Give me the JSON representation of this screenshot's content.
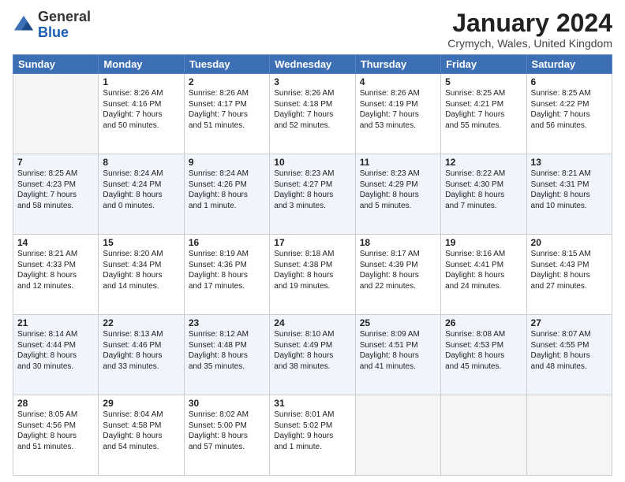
{
  "header": {
    "logo_general": "General",
    "logo_blue": "Blue",
    "month_title": "January 2024",
    "location": "Crymych, Wales, United Kingdom"
  },
  "days_of_week": [
    "Sunday",
    "Monday",
    "Tuesday",
    "Wednesday",
    "Thursday",
    "Friday",
    "Saturday"
  ],
  "weeks": [
    [
      {
        "day": "",
        "info": ""
      },
      {
        "day": "1",
        "info": "Sunrise: 8:26 AM\nSunset: 4:16 PM\nDaylight: 7 hours\nand 50 minutes."
      },
      {
        "day": "2",
        "info": "Sunrise: 8:26 AM\nSunset: 4:17 PM\nDaylight: 7 hours\nand 51 minutes."
      },
      {
        "day": "3",
        "info": "Sunrise: 8:26 AM\nSunset: 4:18 PM\nDaylight: 7 hours\nand 52 minutes."
      },
      {
        "day": "4",
        "info": "Sunrise: 8:26 AM\nSunset: 4:19 PM\nDaylight: 7 hours\nand 53 minutes."
      },
      {
        "day": "5",
        "info": "Sunrise: 8:25 AM\nSunset: 4:21 PM\nDaylight: 7 hours\nand 55 minutes."
      },
      {
        "day": "6",
        "info": "Sunrise: 8:25 AM\nSunset: 4:22 PM\nDaylight: 7 hours\nand 56 minutes."
      }
    ],
    [
      {
        "day": "7",
        "info": "Sunrise: 8:25 AM\nSunset: 4:23 PM\nDaylight: 7 hours\nand 58 minutes."
      },
      {
        "day": "8",
        "info": "Sunrise: 8:24 AM\nSunset: 4:24 PM\nDaylight: 8 hours\nand 0 minutes."
      },
      {
        "day": "9",
        "info": "Sunrise: 8:24 AM\nSunset: 4:26 PM\nDaylight: 8 hours\nand 1 minute."
      },
      {
        "day": "10",
        "info": "Sunrise: 8:23 AM\nSunset: 4:27 PM\nDaylight: 8 hours\nand 3 minutes."
      },
      {
        "day": "11",
        "info": "Sunrise: 8:23 AM\nSunset: 4:29 PM\nDaylight: 8 hours\nand 5 minutes."
      },
      {
        "day": "12",
        "info": "Sunrise: 8:22 AM\nSunset: 4:30 PM\nDaylight: 8 hours\nand 7 minutes."
      },
      {
        "day": "13",
        "info": "Sunrise: 8:21 AM\nSunset: 4:31 PM\nDaylight: 8 hours\nand 10 minutes."
      }
    ],
    [
      {
        "day": "14",
        "info": "Sunrise: 8:21 AM\nSunset: 4:33 PM\nDaylight: 8 hours\nand 12 minutes."
      },
      {
        "day": "15",
        "info": "Sunrise: 8:20 AM\nSunset: 4:34 PM\nDaylight: 8 hours\nand 14 minutes."
      },
      {
        "day": "16",
        "info": "Sunrise: 8:19 AM\nSunset: 4:36 PM\nDaylight: 8 hours\nand 17 minutes."
      },
      {
        "day": "17",
        "info": "Sunrise: 8:18 AM\nSunset: 4:38 PM\nDaylight: 8 hours\nand 19 minutes."
      },
      {
        "day": "18",
        "info": "Sunrise: 8:17 AM\nSunset: 4:39 PM\nDaylight: 8 hours\nand 22 minutes."
      },
      {
        "day": "19",
        "info": "Sunrise: 8:16 AM\nSunset: 4:41 PM\nDaylight: 8 hours\nand 24 minutes."
      },
      {
        "day": "20",
        "info": "Sunrise: 8:15 AM\nSunset: 4:43 PM\nDaylight: 8 hours\nand 27 minutes."
      }
    ],
    [
      {
        "day": "21",
        "info": "Sunrise: 8:14 AM\nSunset: 4:44 PM\nDaylight: 8 hours\nand 30 minutes."
      },
      {
        "day": "22",
        "info": "Sunrise: 8:13 AM\nSunset: 4:46 PM\nDaylight: 8 hours\nand 33 minutes."
      },
      {
        "day": "23",
        "info": "Sunrise: 8:12 AM\nSunset: 4:48 PM\nDaylight: 8 hours\nand 35 minutes."
      },
      {
        "day": "24",
        "info": "Sunrise: 8:10 AM\nSunset: 4:49 PM\nDaylight: 8 hours\nand 38 minutes."
      },
      {
        "day": "25",
        "info": "Sunrise: 8:09 AM\nSunset: 4:51 PM\nDaylight: 8 hours\nand 41 minutes."
      },
      {
        "day": "26",
        "info": "Sunrise: 8:08 AM\nSunset: 4:53 PM\nDaylight: 8 hours\nand 45 minutes."
      },
      {
        "day": "27",
        "info": "Sunrise: 8:07 AM\nSunset: 4:55 PM\nDaylight: 8 hours\nand 48 minutes."
      }
    ],
    [
      {
        "day": "28",
        "info": "Sunrise: 8:05 AM\nSunset: 4:56 PM\nDaylight: 8 hours\nand 51 minutes."
      },
      {
        "day": "29",
        "info": "Sunrise: 8:04 AM\nSunset: 4:58 PM\nDaylight: 8 hours\nand 54 minutes."
      },
      {
        "day": "30",
        "info": "Sunrise: 8:02 AM\nSunset: 5:00 PM\nDaylight: 8 hours\nand 57 minutes."
      },
      {
        "day": "31",
        "info": "Sunrise: 8:01 AM\nSunset: 5:02 PM\nDaylight: 9 hours\nand 1 minute."
      },
      {
        "day": "",
        "info": ""
      },
      {
        "day": "",
        "info": ""
      },
      {
        "day": "",
        "info": ""
      }
    ]
  ]
}
